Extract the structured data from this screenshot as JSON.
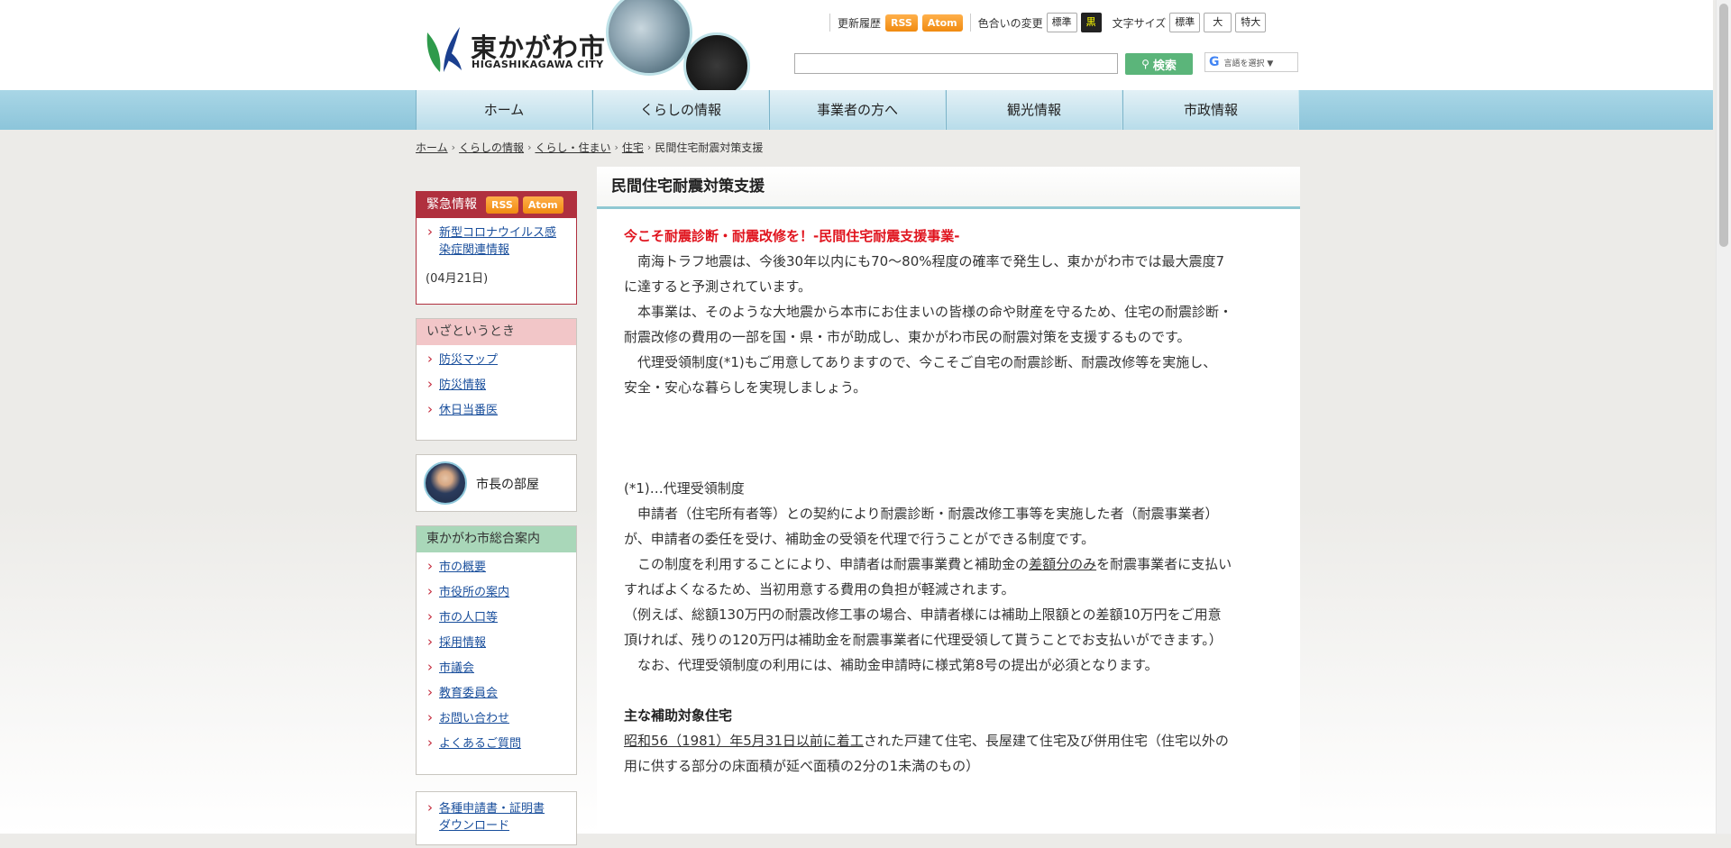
{
  "header": {
    "logo_ja": "東かがわ市",
    "logo_en": "HIGASHIKAGAWA CITY",
    "update_history": "更新履歴",
    "rss": "RSS",
    "atom": "Atom",
    "color_change": "色合いの変更",
    "color_standard": "標準",
    "color_black": "黒",
    "font_size": "文字サイズ",
    "font_standard": "標準",
    "font_large": "大",
    "font_xlarge": "特大",
    "search_button": "検索",
    "search_value": "",
    "lang_select": "言語を選択 ▼"
  },
  "nav": [
    {
      "label": "ホーム"
    },
    {
      "label": "くらしの情報"
    },
    {
      "label": "事業者の方へ"
    },
    {
      "label": "観光情報"
    },
    {
      "label": "市政情報"
    }
  ],
  "breadcrumb": [
    "ホーム",
    "くらしの情報",
    "くらし・住まい",
    "住宅",
    "民間住宅耐震対策支援"
  ],
  "sidebar": {
    "emergency": {
      "title": "緊急情報",
      "rss": "RSS",
      "atom": "Atom",
      "item_line1": "新型コロナウイルス感",
      "item_line2": "染症関連情報",
      "date": "(04月21日)"
    },
    "disaster": {
      "title": "いざというとき",
      "items": [
        "防災マップ",
        "防災情報",
        "休日当番医"
      ]
    },
    "mayor": "市長の部屋",
    "guide": {
      "title": "東かがわ市総合案内",
      "items": [
        "市の概要",
        "市役所の案内",
        "市の人口等",
        "採用情報",
        "市議会",
        "教育委員会",
        "お問い合わせ",
        "よくあるご質問"
      ]
    },
    "forms": {
      "line1": "各種申請書・証明書",
      "line2": "ダウンロード"
    }
  },
  "main": {
    "title": "民間住宅耐震対策支援",
    "red_heading": "今こそ耐震診断・耐震改修を！-民間住宅耐震支援事業-",
    "para1_a": "　南海トラフ地震は、今後30年以内にも70～80%程度の確率で発生し、東かがわ市では最大震度7",
    "para1_b": "に達すると予測されています。",
    "para2_a": "　本事業は、そのような大地震から本市にお住まいの皆様の命や財産を守るため、住宅の耐震診断・",
    "para2_b": "耐震改修の費用の一部を国・県・市が助成し、東かがわ市民の耐震対策を支援するものです。",
    "para3_a": "　代理受領制度(*1)もご用意してありますので、今こそご自宅の耐震診断、耐震改修等を実施し、",
    "para3_b": "安全・安心な暮らしを実現しましょう。",
    "note_head": "(*1)…代理受領制度",
    "note1_a": "　申請者（住宅所有者等）との契約により耐震診断・耐震改修工事等を実施した者（耐震事業者）",
    "note1_b": "が、申請者の委任を受け、補助金の受領を代理で行うことができる制度です。",
    "note2_pre": "　この制度を利用することにより、申請者は耐震事業費と補助金の",
    "note2_link": "差額分のみ",
    "note2_post": "を耐震事業者に支払い",
    "note2_b": "すればよくなるため、当初用意する費用の負担が軽減されます。",
    "note3_a": "（例えば、総額130万円の耐震改修工事の場合、申請者様には補助上限額との差額10万円をご用意",
    "note3_b": "頂ければ、残りの120万円は補助金を耐震事業者に代理受領して貰うことでお支払いができます。）",
    "note4": "　なお、代理受領制度の利用には、補助金申請時に様式第8号の提出が必須となります。",
    "target_head": "主な補助対象住宅",
    "target_link": "昭和56（1981）年5月31日以前に着工",
    "target_a": "された戸建て住宅、長屋建て住宅及び併用住宅（住宅以外の",
    "target_b": "用に供する部分の床面積が延べ面積の2分の1未満のもの）"
  }
}
